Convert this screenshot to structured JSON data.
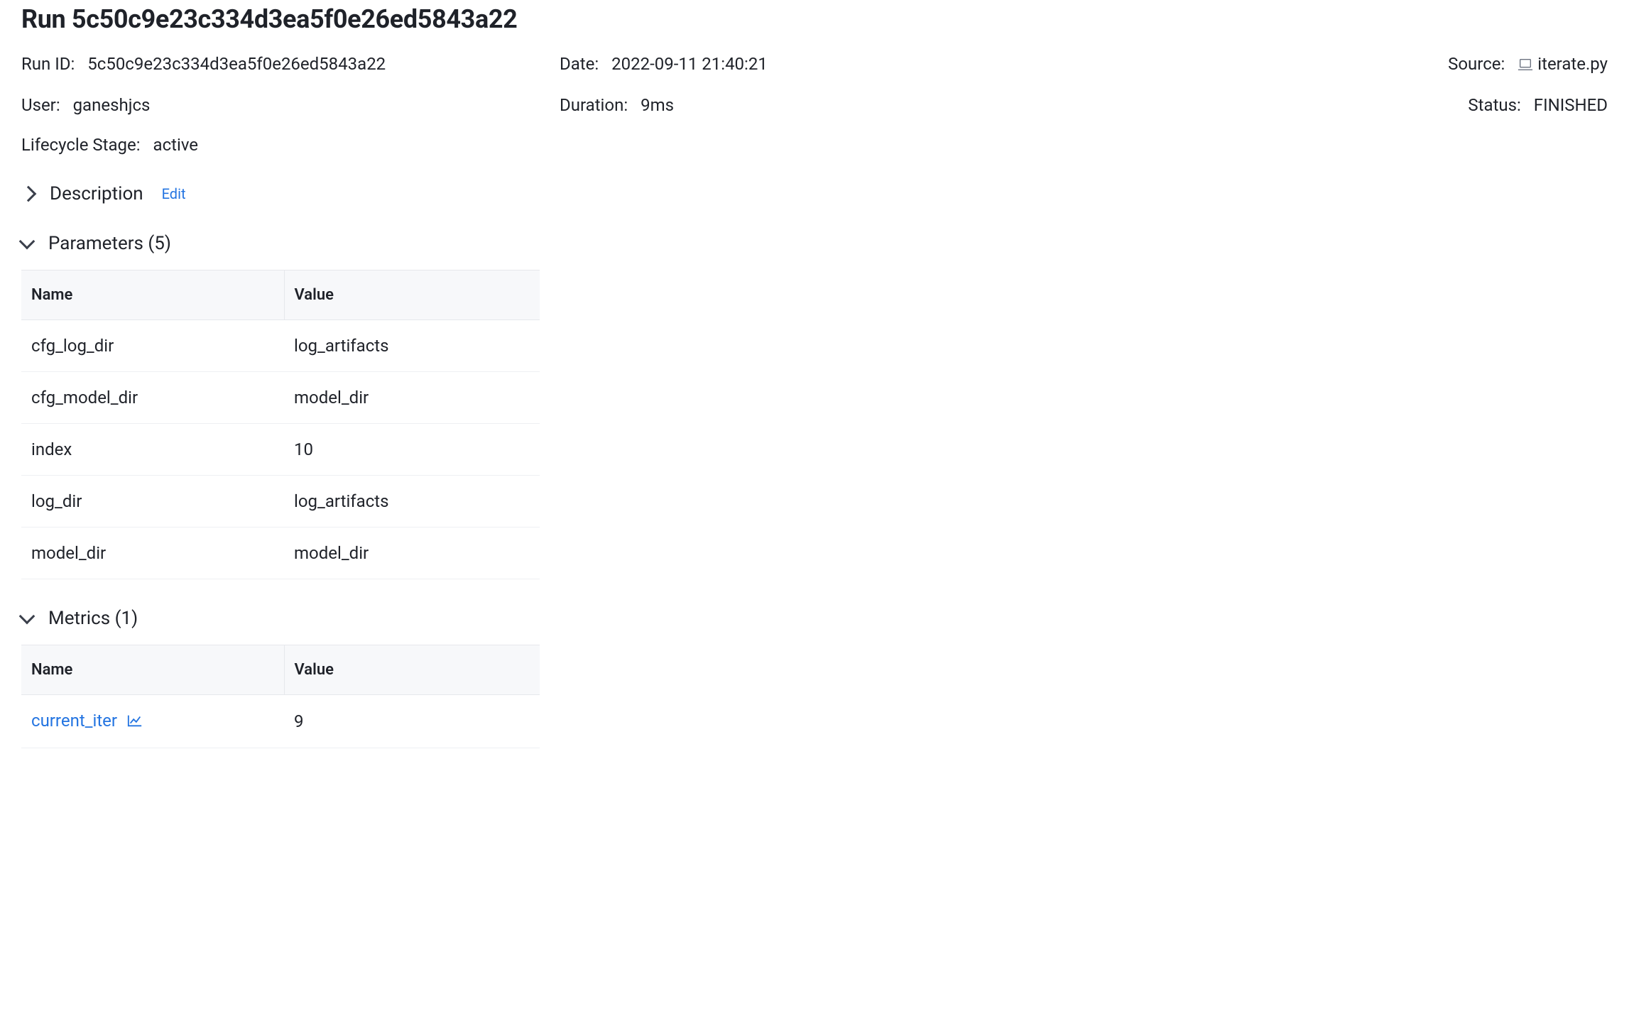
{
  "title_prefix": "Run ",
  "run_id_h": "5c50c9e23c334d3ea5f0e26ed5843a22",
  "meta": {
    "run_id": {
      "label": "Run ID",
      "value": "5c50c9e23c334d3ea5f0e26ed5843a22"
    },
    "date": {
      "label": "Date",
      "value": "2022-09-11 21:40:21"
    },
    "source": {
      "label": "Source",
      "value": "iterate.py"
    },
    "user": {
      "label": "User",
      "value": "ganeshjcs"
    },
    "duration": {
      "label": "Duration",
      "value": "9ms"
    },
    "status": {
      "label": "Status",
      "value": "FINISHED"
    },
    "lifecycle": {
      "label": "Lifecycle Stage",
      "value": "active"
    }
  },
  "sections": {
    "description": {
      "title": "Description",
      "edit": "Edit"
    },
    "parameters": {
      "title": "Parameters (5)",
      "cols": {
        "name": "Name",
        "value": "Value"
      },
      "rows": [
        {
          "name": "cfg_log_dir",
          "value": "log_artifacts"
        },
        {
          "name": "cfg_model_dir",
          "value": "model_dir"
        },
        {
          "name": "index",
          "value": "10"
        },
        {
          "name": "log_dir",
          "value": "log_artifacts"
        },
        {
          "name": "model_dir",
          "value": "model_dir"
        }
      ]
    },
    "metrics": {
      "title": "Metrics (1)",
      "cols": {
        "name": "Name",
        "value": "Value"
      },
      "rows": [
        {
          "name": "current_iter",
          "value": "9"
        }
      ]
    }
  }
}
